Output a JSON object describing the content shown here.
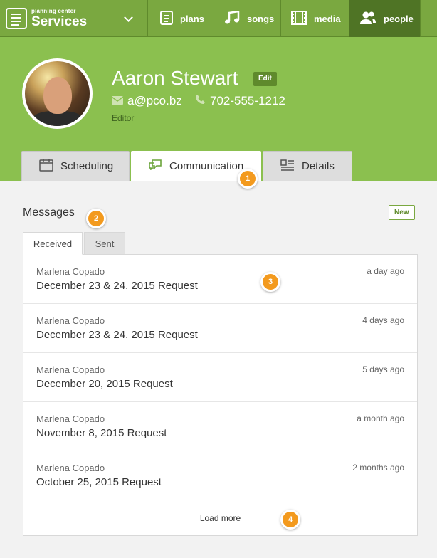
{
  "nav": {
    "brand_small": "planning center",
    "brand_big": "Services",
    "items": [
      {
        "label": "plans",
        "icon": "document-icon"
      },
      {
        "label": "songs",
        "icon": "music-note-icon"
      },
      {
        "label": "media",
        "icon": "film-icon"
      },
      {
        "label": "people",
        "icon": "people-icon"
      }
    ]
  },
  "profile": {
    "name": "Aaron Stewart",
    "edit_label": "Edit",
    "email": "a@pco.bz",
    "phone": "702-555-1212",
    "role": "Editor"
  },
  "tabs": [
    {
      "label": "Scheduling",
      "icon": "calendar-icon"
    },
    {
      "label": "Communication",
      "icon": "chat-icon",
      "active": true
    },
    {
      "label": "Details",
      "icon": "details-icon"
    }
  ],
  "messages": {
    "title": "Messages",
    "new_label": "New",
    "tabs": [
      {
        "label": "Received",
        "active": true
      },
      {
        "label": "Sent"
      }
    ],
    "items": [
      {
        "sender": "Marlena Copado",
        "subject": "December 23 & 24, 2015 Request",
        "time": "a day ago"
      },
      {
        "sender": "Marlena Copado",
        "subject": "December 23 & 24, 2015 Request",
        "time": "4 days ago"
      },
      {
        "sender": "Marlena Copado",
        "subject": "December 20, 2015 Request",
        "time": "5 days ago"
      },
      {
        "sender": "Marlena Copado",
        "subject": "November 8, 2015 Request",
        "time": "a month ago"
      },
      {
        "sender": "Marlena Copado",
        "subject": "October 25, 2015 Request",
        "time": "2 months ago"
      }
    ],
    "load_more": "Load more"
  },
  "badges": [
    "1",
    "2",
    "3",
    "4"
  ],
  "colors": {
    "nav_green": "#7aa840",
    "header_green": "#8bc04f",
    "active_nav": "#4f7425",
    "badge_orange": "#f39a1e"
  }
}
